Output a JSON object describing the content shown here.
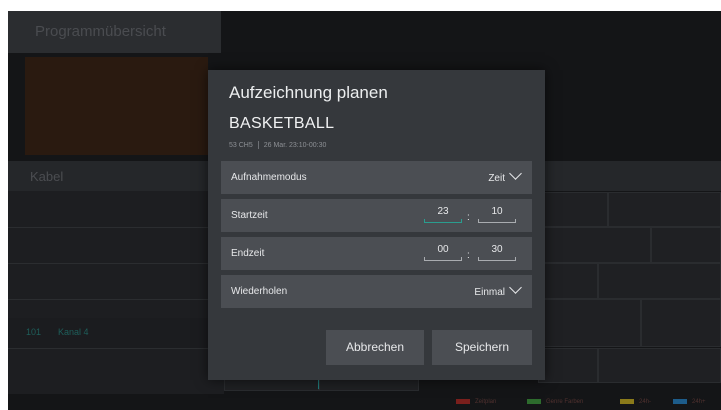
{
  "background": {
    "title": "Programmübersicht",
    "channel_group": "Kabel",
    "channel_number": "101",
    "channel_name": "Kanal 4",
    "legend": [
      {
        "label": "Zeitplan",
        "color": "#7a1f1c"
      },
      {
        "label": "Genre Farben",
        "color": "#2d6b2d"
      },
      {
        "label": "24h-",
        "color": "#8a7a1a"
      },
      {
        "label": "24h+",
        "color": "#1d5c8a"
      }
    ]
  },
  "dialog": {
    "title": "Aufzeichnung planen",
    "program_name": "BASKETBALL",
    "channel": "53 CH5",
    "airtime": "26 Mar. 23:10-00:30",
    "mode": {
      "label": "Aufnahmemodus",
      "value": "Zeit"
    },
    "start": {
      "label": "Startzeit",
      "hour": "23",
      "minute": "10"
    },
    "end": {
      "label": "Endzeit",
      "hour": "00",
      "minute": "30"
    },
    "repeat": {
      "label": "Wiederholen",
      "value": "Einmal"
    },
    "time_separator": ":",
    "cancel_label": "Abbrechen",
    "save_label": "Speichern"
  },
  "colors": {
    "accent": "#2a9d8f",
    "dialog_bg": "#35383c",
    "row_bg": "#4b4e53"
  }
}
